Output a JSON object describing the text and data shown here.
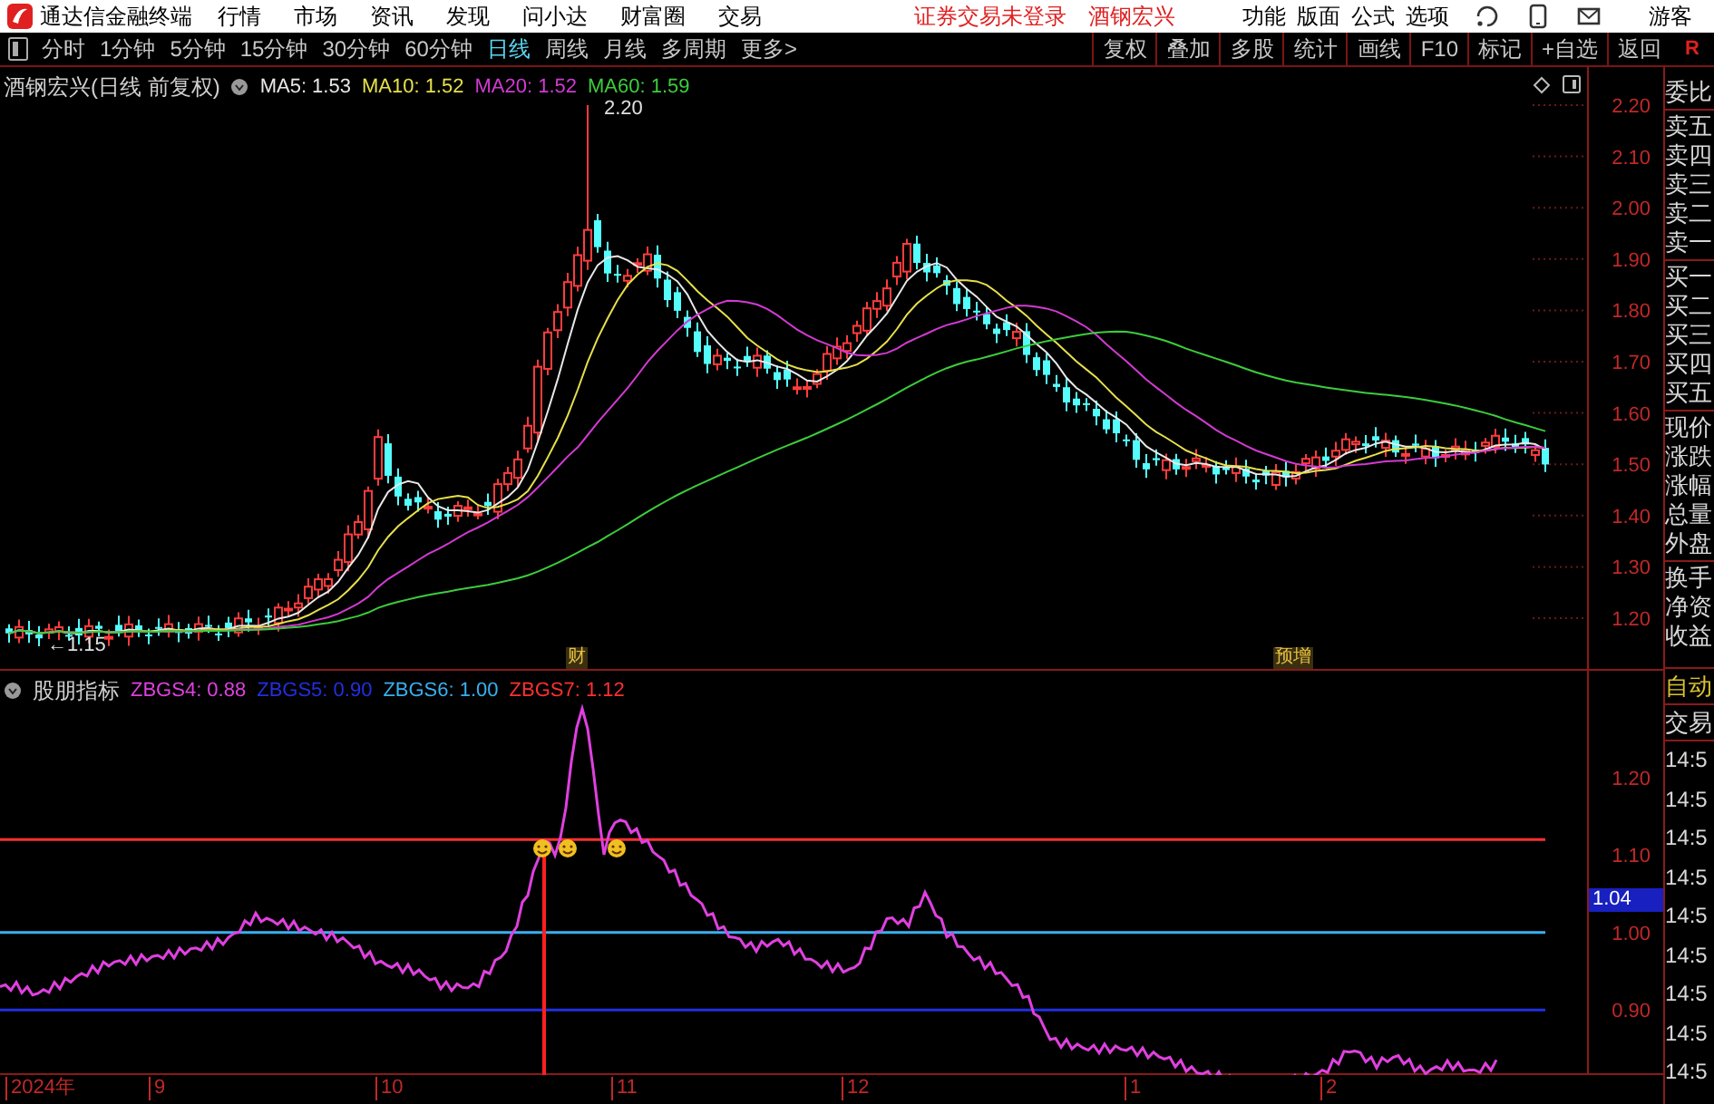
{
  "app": {
    "title": "通达信金融终端"
  },
  "menu": [
    {
      "label": "行情"
    },
    {
      "label": "市场"
    },
    {
      "label": "资讯"
    },
    {
      "label": "发现"
    },
    {
      "label": "问小达"
    },
    {
      "label": "财富圈"
    },
    {
      "label": "交易"
    }
  ],
  "notices": [
    {
      "label": "证券交易未登录"
    },
    {
      "label": "酒钢宏兴"
    }
  ],
  "right_menu": [
    {
      "label": "功能"
    },
    {
      "label": "版面"
    },
    {
      "label": "公式"
    },
    {
      "label": "选项"
    }
  ],
  "user": {
    "label": "游客"
  },
  "periods": [
    {
      "label": "分时",
      "selected": false
    },
    {
      "label": "1分钟",
      "selected": false
    },
    {
      "label": "5分钟",
      "selected": false
    },
    {
      "label": "15分钟",
      "selected": false
    },
    {
      "label": "30分钟",
      "selected": false
    },
    {
      "label": "60分钟",
      "selected": false
    },
    {
      "label": "日线",
      "selected": true
    },
    {
      "label": "周线",
      "selected": false
    },
    {
      "label": "月线",
      "selected": false
    },
    {
      "label": "多周期",
      "selected": false
    },
    {
      "label": "更多>",
      "selected": false
    }
  ],
  "tools": [
    {
      "label": "复权"
    },
    {
      "label": "叠加"
    },
    {
      "label": "多股"
    },
    {
      "label": "统计"
    },
    {
      "label": "画线"
    },
    {
      "label": "F10"
    },
    {
      "label": "标记"
    },
    {
      "label": "+自选"
    },
    {
      "label": "返回"
    }
  ],
  "corner": {
    "label": "R"
  },
  "price_pane": {
    "title": "酒钢宏兴(日线 前复权)",
    "legend": [
      {
        "label": "MA5: 1.53",
        "color": "#e8e8e8"
      },
      {
        "label": "MA10: 1.52",
        "color": "#e6e04a"
      },
      {
        "label": "MA20: 1.52",
        "color": "#d23ad2"
      },
      {
        "label": "MA60: 1.59",
        "color": "#3ccc3c"
      }
    ],
    "yticks": [
      "2.20",
      "2.10",
      "2.00",
      "1.90",
      "1.80",
      "1.70",
      "1.60",
      "1.50",
      "1.40",
      "1.30",
      "1.20"
    ],
    "high_mark": "2.20",
    "low_mark": "←1.15",
    "event_tags": [
      {
        "label": "财"
      },
      {
        "label": "预增"
      }
    ]
  },
  "indicator_pane": {
    "title": "股朋指标",
    "legend": [
      {
        "label": "ZBGS4: 0.88",
        "color": "#e040e0"
      },
      {
        "label": "ZBGS5: 0.90",
        "color": "#2030e0"
      },
      {
        "label": "ZBGS6: 1.00",
        "color": "#38b0f0"
      },
      {
        "label": "ZBGS7: 1.12",
        "color": "#ff3030"
      }
    ],
    "yticks": [
      "1.20",
      "1.10",
      "1.00",
      "0.90"
    ],
    "current_value": "1.04"
  },
  "date_axis": [
    "2024年",
    "9",
    "10",
    "11",
    "12",
    "1",
    "2"
  ],
  "sidebar": {
    "groups": [
      [
        "委比"
      ],
      [
        "卖五",
        "卖四",
        "卖三",
        "卖二",
        "卖一"
      ],
      [
        "买一",
        "买二",
        "买三",
        "买四",
        "买五"
      ],
      [
        "现价",
        "涨跌",
        "涨幅",
        "总量",
        "外盘"
      ],
      [
        "换手",
        "净资",
        "收益"
      ]
    ],
    "mode": "自动",
    "trade": "交易",
    "times": [
      "14:5",
      "14:5",
      "14:5",
      "14:5",
      "14:5",
      "14:5",
      "14:5",
      "14:5",
      "14:5"
    ]
  }
}
